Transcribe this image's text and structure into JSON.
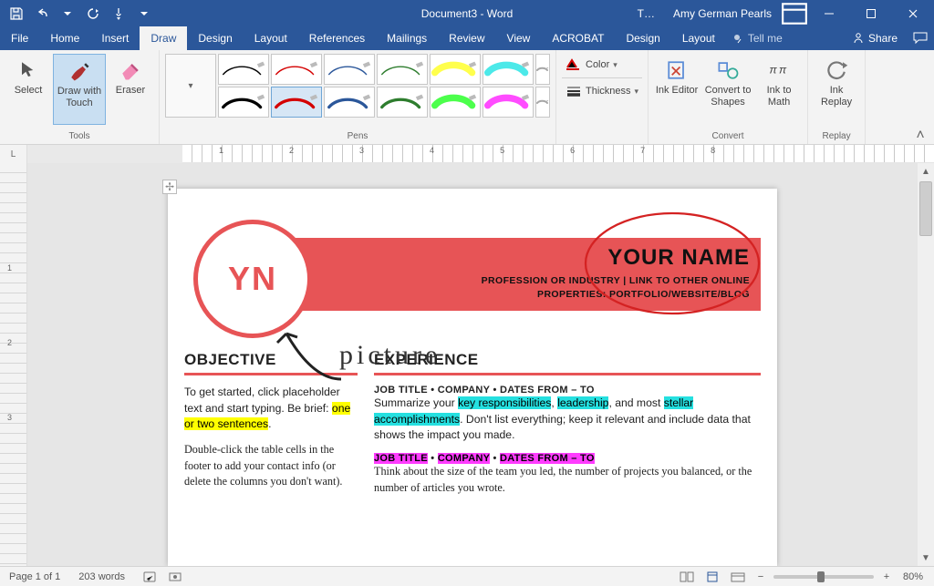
{
  "title": "Document3 - Word",
  "user": "Amy German Pearls",
  "tabs": [
    "File",
    "Home",
    "Insert",
    "Draw",
    "Design",
    "Layout",
    "References",
    "Mailings",
    "Review",
    "View",
    "ACROBAT",
    "Design",
    "Layout"
  ],
  "active_tab": "Draw",
  "tellme": "Tell me",
  "share": "Share",
  "ribbon": {
    "tools_label": "Tools",
    "select": "Select",
    "draw_touch": "Draw with Touch",
    "eraser": "Eraser",
    "pens_label": "Pens",
    "color": "Color",
    "thickness": "Thickness",
    "ink_editor": "Ink Editor",
    "convert_shapes": "Convert to Shapes",
    "ink_math": "Ink to Math",
    "convert_label": "Convert",
    "ink_replay": "Ink Replay",
    "replay_label": "Replay"
  },
  "pen_colors": {
    "row1": [
      "#000000",
      "#d40000",
      "#2b579a",
      "#2e7d2e",
      "#ffff00",
      "#00e0e0",
      "#808080"
    ],
    "row2": [
      "#000000",
      "#d40000",
      "#2b579a",
      "#2e7d2e",
      "#00ff00",
      "#ff00ff",
      "#808080"
    ]
  },
  "ruler_h": [
    "1",
    "2",
    "3",
    "4",
    "5",
    "6",
    "7",
    "8"
  ],
  "ruler_v": [
    "1",
    "2",
    "3"
  ],
  "doc": {
    "yn": "YN",
    "name": "YOUR NAME",
    "sub1": "PROFESSION OR INDUSTRY | LINK TO OTHER ONLINE",
    "sub2": "PROPERTIES: PORTFOLIO/WEBSITE/BLOG",
    "ink_word": "picture",
    "objective_h": "OBJECTIVE",
    "objective_p1a": "To get started, click placeholder text and start typing. Be brief: ",
    "objective_hl": "one or two sentences",
    "objective_p1b": ".",
    "objective_p2": "Double-click the table cells in the footer to add your contact info (or delete the columns you don't want).",
    "experience_h": "EXPERIENCE",
    "job1_line": "JOB TITLE • COMPANY • DATES FROM – TO",
    "job1_a": "Summarize your ",
    "job1_h1": "key responsibilities",
    "job1_b": ", ",
    "job1_h2": "leadership",
    "job1_c": ", and most ",
    "job1_h3": "stellar accomplishments",
    "job1_d": ".  Don't list everything; keep it relevant and include data that shows the impact you made.",
    "job2_jt": "JOB TITLE",
    "job2_co": "COMPANY",
    "job2_dt": "DATES FROM – TO",
    "job2_sep": " • ",
    "job2_p": "Think about the size of the team you led, the number of projects you balanced, or the number of articles you wrote."
  },
  "status": {
    "page": "Page 1 of 1",
    "words": "203 words",
    "zoom": "80%"
  }
}
